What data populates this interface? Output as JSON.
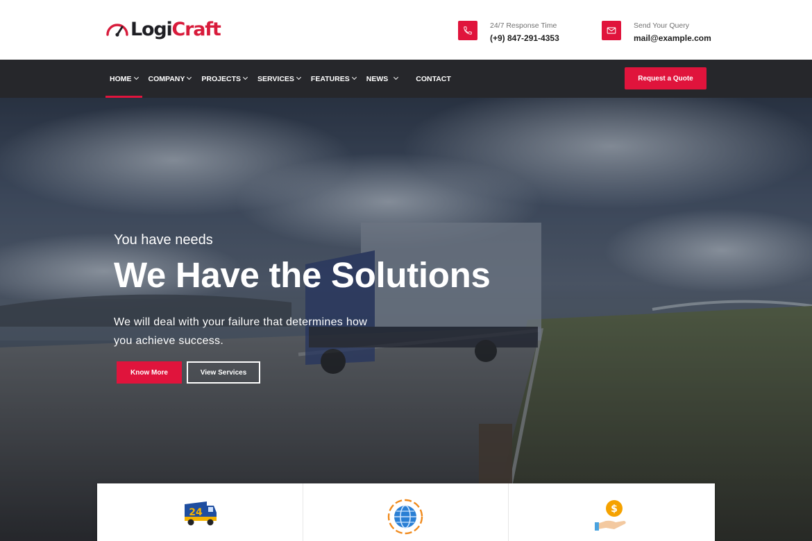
{
  "brand": {
    "part1": "Logi",
    "part2": "Craft",
    "accent": "#e0143c",
    "dark": "#26272b"
  },
  "contact": {
    "phone": {
      "label": "24/7 Response Time",
      "value": "(+9) 847-291-4353",
      "icon": "phone-icon"
    },
    "mail": {
      "label": "Send Your Query",
      "value": "mail@example.com",
      "icon": "mail-icon"
    }
  },
  "nav": {
    "items": [
      {
        "label": "HOME",
        "dropdown": true,
        "active": true
      },
      {
        "label": "COMPANY",
        "dropdown": true
      },
      {
        "label": "PROJECTS",
        "dropdown": true
      },
      {
        "label": "SERVICES",
        "dropdown": true
      },
      {
        "label": "FEATURES",
        "dropdown": true
      },
      {
        "label": "NEWS",
        "dropdown": true
      },
      {
        "label": "CONTACT",
        "dropdown": false
      }
    ],
    "cta": "Request a Quote"
  },
  "hero": {
    "subtitle": "You have needs",
    "headline": "We Have the Solutions",
    "description": "We will deal with your failure that determines how you achieve success.",
    "primary_button": "Know More",
    "secondary_button": "View Services"
  },
  "features": [
    {
      "icon": "delivery-truck-24-icon"
    },
    {
      "icon": "globe-icon"
    },
    {
      "icon": "money-hand-icon"
    }
  ]
}
